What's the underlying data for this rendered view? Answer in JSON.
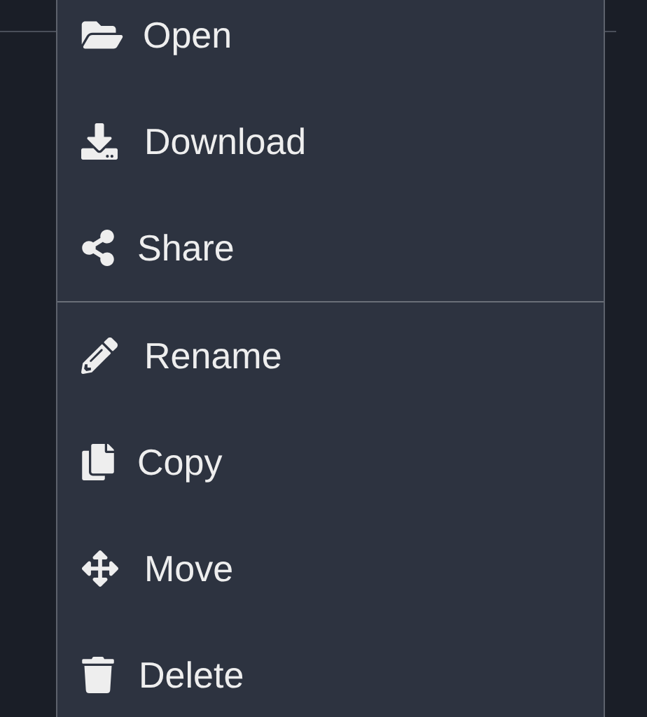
{
  "menu": {
    "groups": [
      {
        "items": [
          {
            "label": "Open"
          },
          {
            "label": "Download"
          },
          {
            "label": "Share"
          }
        ]
      },
      {
        "items": [
          {
            "label": "Rename"
          },
          {
            "label": "Copy"
          },
          {
            "label": "Move"
          },
          {
            "label": "Delete"
          }
        ]
      }
    ]
  }
}
